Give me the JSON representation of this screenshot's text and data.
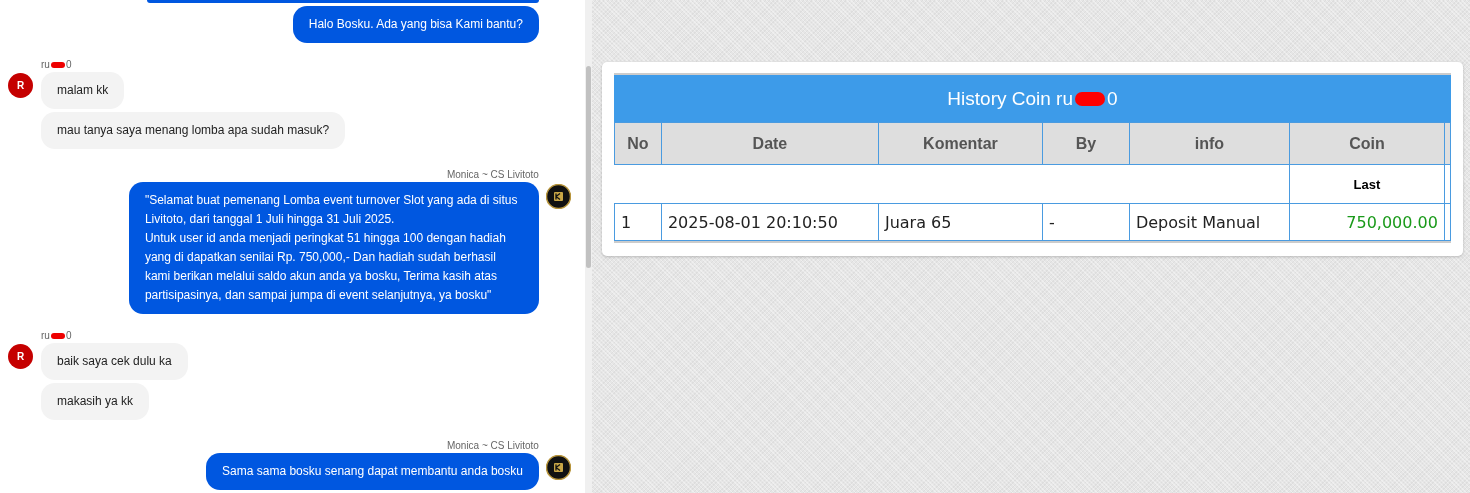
{
  "chat": {
    "groups": [
      {
        "kind": "agent",
        "partial_top": true,
        "messages": [
          "Halo Bosku. Ada yang bisa Kami bantu?"
        ]
      },
      {
        "kind": "user",
        "sender": {
          "prefix": "ru",
          "suffix": "0",
          "redacted": true
        },
        "avatar": "R",
        "messages": [
          "malam kk",
          "mau tanya saya menang lomba apa sudah masuk?"
        ]
      },
      {
        "kind": "agent",
        "sender_label": "Monica ~ CS Livitoto",
        "messages": [
          "\"Selamat buat pemenang Lomba event turnover Slot yang ada di situs Livitoto, dari tanggal 1 Juli hingga 31 Juli 2025.\nUntuk user id anda menjadi peringkat 51 hingga 100 dengan hadiah yang di dapatkan senilai Rp. 750,000,- Dan hadiah sudah berhasil kami berikan melalui saldo akun anda ya bosku, Terima kasih atas partisipasinya, dan sampai jumpa di event selanjutnya, ya bosku\""
        ]
      },
      {
        "kind": "user",
        "sender": {
          "prefix": "ru",
          "suffix": "0",
          "redacted": true
        },
        "avatar": "R",
        "messages": [
          "baik saya cek dulu ka",
          "makasih ya kk"
        ]
      },
      {
        "kind": "agent",
        "sender_label": "Monica ~ CS Livitoto",
        "messages": [
          "Sama sama bosku senang dapat membantu anda bosku"
        ]
      }
    ]
  },
  "history": {
    "title": {
      "prefix": "History Coin ru",
      "suffix": "0",
      "redacted": true
    },
    "columns": [
      "No",
      "Date",
      "Komentar",
      "By",
      "info",
      "Coin"
    ],
    "subheader": "Last",
    "rows": [
      {
        "cells": [
          "1",
          "2025-08-01 20:10:50",
          "Juara 65",
          "-",
          "Deposit Manual",
          "750,000.00"
        ]
      }
    ]
  }
}
